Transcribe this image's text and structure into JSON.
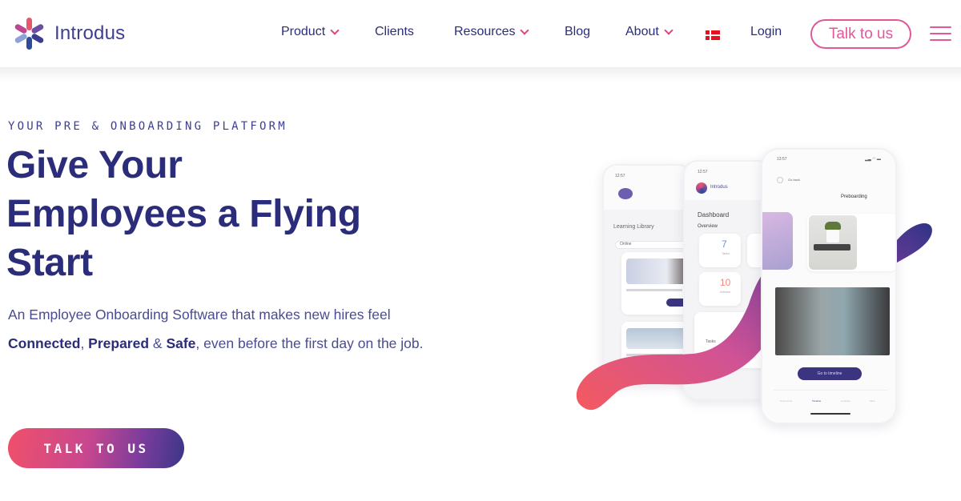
{
  "brand": {
    "name": "Introdus",
    "logo_icon": "asterisk-logo-icon"
  },
  "nav": {
    "items": [
      {
        "label": "Product",
        "has_dropdown": true
      },
      {
        "label": "Clients",
        "has_dropdown": false
      },
      {
        "label": "Resources",
        "has_dropdown": true
      },
      {
        "label": "Blog",
        "has_dropdown": false
      },
      {
        "label": "About",
        "has_dropdown": true
      }
    ],
    "language_flag": "danish-flag-icon",
    "login_label": "Login",
    "talk_button_label": "Talk to us",
    "menu_icon": "hamburger-menu-icon"
  },
  "hero": {
    "eyebrow": "YOUR PRE & ONBOARDING PLATFORM",
    "headline_lines": [
      "Give Your",
      "Employees a Flying",
      "Start"
    ],
    "subtitle": {
      "part1": "An Employee Onboarding Software that makes new hires feel ",
      "bold1": "Connected",
      "sep1": ", ",
      "bold2": "Prepared",
      "sep2": " & ",
      "bold3": "Safe",
      "part2": ", even before the first day on the job."
    },
    "cta_label": "TALK TO US"
  },
  "mockup": {
    "phone_left": {
      "title": "Learning Library",
      "filter": "Online"
    },
    "phone_middle": {
      "brand": "Introdus",
      "title": "Dashboard",
      "section": "Overview",
      "stats": [
        {
          "value": "7",
          "label": "Tasks"
        },
        {
          "value": "10",
          "label": "Articles"
        }
      ],
      "tab": "Tasks"
    },
    "phone_right": {
      "time": "13:57",
      "back_label": "Go back",
      "title": "Preboarding",
      "button_label": "Go to timeline",
      "tabs": [
        "Documents",
        "Timeline",
        "Contacts",
        "More"
      ]
    }
  },
  "colors": {
    "primary": "#2b2d7a",
    "accent_pink": "#e0589a",
    "gradient_start": "#f0506a",
    "gradient_end": "#3a3688"
  }
}
